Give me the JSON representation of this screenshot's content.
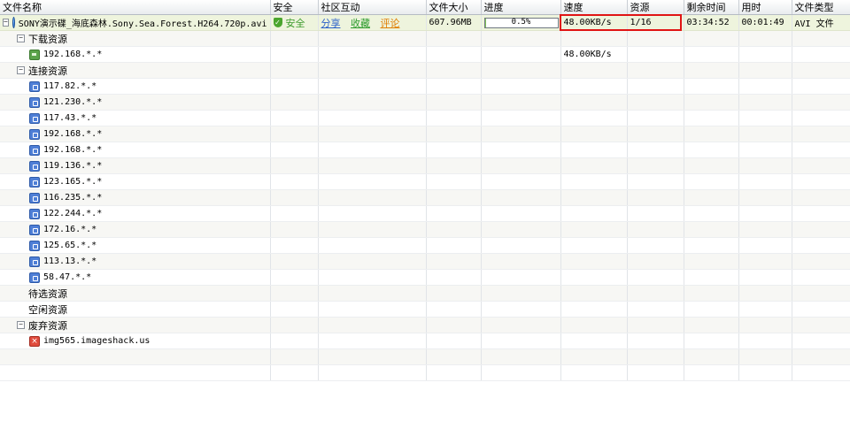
{
  "columns": {
    "name": "文件名称",
    "safety": "安全",
    "community": "社区互动",
    "size": "文件大小",
    "progress": "进度",
    "speed": "速度",
    "resources": "资源",
    "remaining": "剩余时间",
    "elapsed": "用时",
    "type": "文件类型"
  },
  "task": {
    "toggle": "−",
    "icon": "task-icon",
    "name": "SONY演示碟_海底森林.Sony.Sea.Forest.H264.720p.avi",
    "safety_icon": "shield-icon",
    "safety_text": "安全",
    "share": "分享",
    "favorite": "收藏",
    "comment": "评论",
    "size": "607.96MB",
    "progress_percent": 0.5,
    "progress_text": "0.5%",
    "speed": "48.00KB/s",
    "resources": "1/16",
    "remaining": "03:34:52",
    "elapsed": "00:01:49",
    "type": "AVI 文件"
  },
  "groups": {
    "downloading": {
      "toggle": "−",
      "label": "下载资源"
    },
    "connected": {
      "toggle": "−",
      "label": "连接资源"
    },
    "pending": {
      "label": "待选资源"
    },
    "idle": {
      "label": "空闲资源"
    },
    "discarded": {
      "toggle": "−",
      "label": "废弃资源"
    }
  },
  "downloading_peers": [
    {
      "ip": "192.168.*.*",
      "speed": "48.00KB/s",
      "icon": "local-peer-icon"
    }
  ],
  "connected_peers": [
    {
      "ip": "117.82.*.*",
      "icon": "peer-icon"
    },
    {
      "ip": "121.230.*.*",
      "icon": "peer-icon"
    },
    {
      "ip": "117.43.*.*",
      "icon": "peer-icon"
    },
    {
      "ip": "192.168.*.*",
      "icon": "peer-icon"
    },
    {
      "ip": "192.168.*.*",
      "icon": "peer-icon"
    },
    {
      "ip": "119.136.*.*",
      "icon": "peer-icon"
    },
    {
      "ip": "123.165.*.*",
      "icon": "peer-icon"
    },
    {
      "ip": "116.235.*.*",
      "icon": "peer-icon"
    },
    {
      "ip": "122.244.*.*",
      "icon": "peer-icon"
    },
    {
      "ip": "172.16.*.*",
      "icon": "peer-icon"
    },
    {
      "ip": "125.65.*.*",
      "icon": "peer-icon"
    },
    {
      "ip": "113.13.*.*",
      "icon": "peer-icon"
    },
    {
      "ip": "58.47.*.*",
      "icon": "peer-icon"
    }
  ],
  "discarded_peers": [
    {
      "ip": "img565.imageshack.us",
      "icon": "blocked-peer-icon"
    }
  ],
  "colors": {
    "selected_row": "#eef4dd",
    "highlight_box": "#e01414",
    "progress_fill": "#7fc35a"
  }
}
